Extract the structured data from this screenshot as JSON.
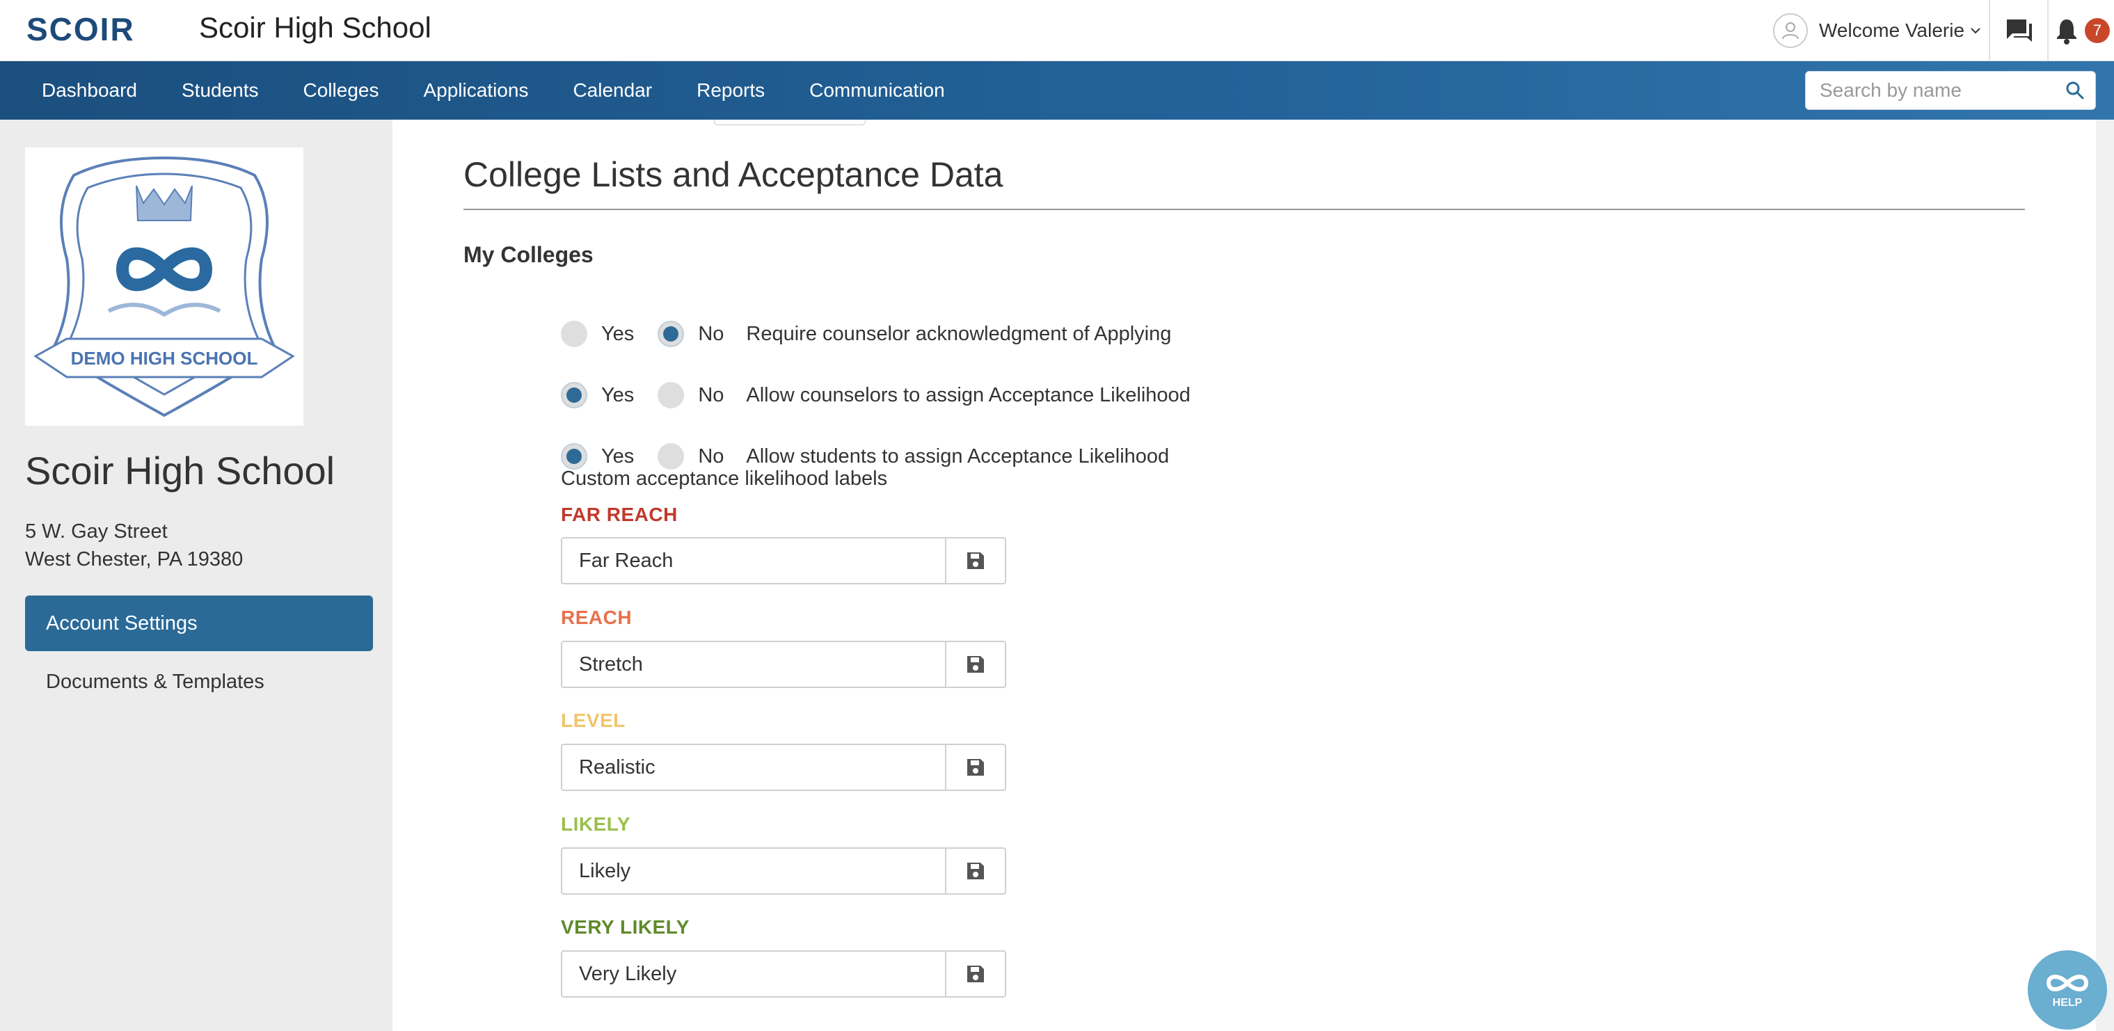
{
  "header": {
    "logo_text": "SCOIR",
    "school_title": "Scoir High School",
    "welcome": "Welcome Valerie",
    "notifications_count": "7"
  },
  "nav": {
    "items": [
      "Dashboard",
      "Students",
      "Colleges",
      "Applications",
      "Calendar",
      "Reports",
      "Communication"
    ],
    "search_placeholder": "Search by name"
  },
  "sidebar": {
    "crest_text": "DEMO HIGH SCHOOL",
    "school_name": "Scoir High School",
    "address_line1": "5 W. Gay Street",
    "address_line2": "West Chester, PA 19380",
    "menu": [
      "Account Settings",
      "Documents & Templates"
    ]
  },
  "main": {
    "page_title": "College Lists and Acceptance Data",
    "section_title": "My Colleges",
    "yes_label": "Yes",
    "no_label": "No",
    "options": [
      {
        "description": "Require counselor acknowledgment of Applying",
        "selected": "No"
      },
      {
        "description": "Allow counselors to assign Acceptance Likelihood",
        "selected": "Yes"
      },
      {
        "description": "Allow students to assign Acceptance Likelihood",
        "selected": "Yes"
      }
    ],
    "custom_labels_title": "Custom acceptance likelihood labels",
    "likelihood": [
      {
        "label": "FAR REACH",
        "value": "Far Reach",
        "color": "#c0392b"
      },
      {
        "label": "REACH",
        "value": "Stretch",
        "color": "#e8704a"
      },
      {
        "label": "LEVEL",
        "value": "Realistic",
        "color": "#f2c56b"
      },
      {
        "label": "LIKELY",
        "value": "Likely",
        "color": "#9bbf4f"
      },
      {
        "label": "VERY LIKELY",
        "value": "Very Likely",
        "color": "#5f8a2a"
      }
    ]
  },
  "help": {
    "label": "HELP"
  }
}
